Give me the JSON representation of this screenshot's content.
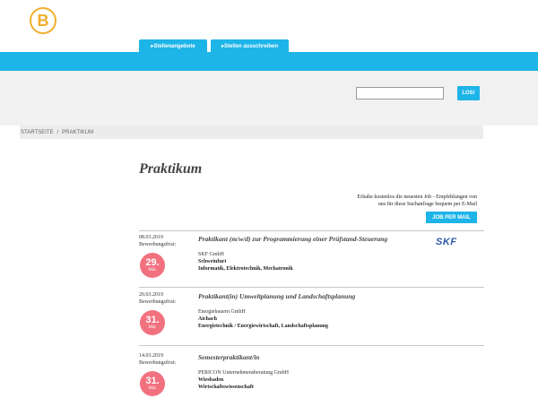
{
  "brand": {
    "logo_glyph": "B",
    "accent": "#f2ae2e"
  },
  "nav": {
    "tabs": [
      {
        "label": "▸Stellenangebote"
      },
      {
        "label": "▸Stellen ausschreiben"
      }
    ]
  },
  "search": {
    "value": "",
    "button_label": "LOS!"
  },
  "breadcrumb": {
    "home": "STARTSEITE",
    "separator": "/",
    "current": "PRAKTIKUM"
  },
  "page": {
    "title": "Praktikum"
  },
  "job_alert": {
    "text_line1": "Erhalte kostenlos die neuesten Job - Empfehlungen von",
    "text_line2": "uns für diese Suchanfrage bequem per E-Mail",
    "button_label": "JOB PER MAIL"
  },
  "deadline_label": "Bewerbungsfrist:",
  "jobs": [
    {
      "date": "08.03.2019",
      "deadline_day": "29.",
      "deadline_month": "Mär.",
      "title": "Praktikant (m/w/d) zur Programmierung einer Prüfstand-Steuerung",
      "company": "SKF GmbH",
      "location": "Schweinfurt",
      "fields": "Informatik, Elektrotechnik, Mechatronik",
      "logo": "SKF"
    },
    {
      "date": "20.03.2019",
      "deadline_day": "31.",
      "deadline_month": "Mär.",
      "title": "Praktikant(in) Umweltplanung und Landschaftsplanung",
      "company": "Energiebauern GmbH",
      "location": "Aichach",
      "fields": "Energietechnik / Energiewirtschaft, Landschaftsplanung"
    },
    {
      "date": "14.03.2019",
      "deadline_day": "31.",
      "deadline_month": "Mär.",
      "title": "Semesterpraktikant/in",
      "company": "PERICON Unternehmensberatung GmbH",
      "location": "Wiesbaden",
      "fields": "Wirtschaftswissenschaft"
    }
  ],
  "colors": {
    "primary": "#1db4e8",
    "badge": "#f2717f",
    "skf": "#2c5aa8"
  }
}
